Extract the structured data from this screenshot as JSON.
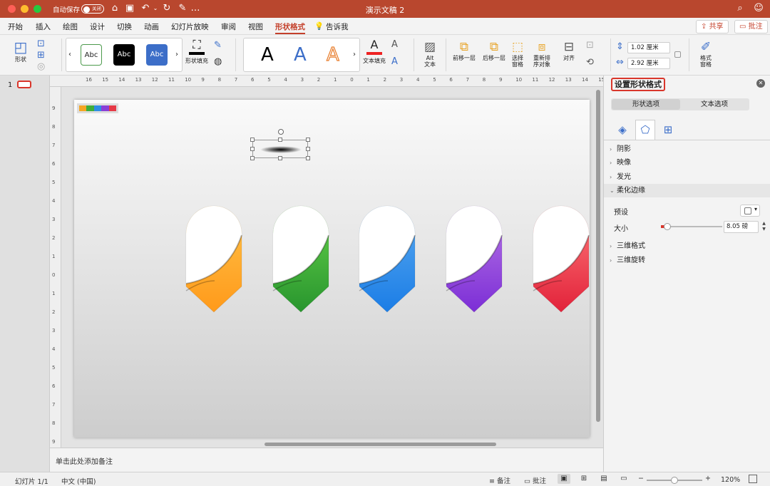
{
  "titlebar": {
    "autosave_label": "自动保存",
    "autosave_state": "关闭",
    "doc_title": "演示文稿 2"
  },
  "menu": {
    "tabs": [
      "开始",
      "插入",
      "绘图",
      "设计",
      "切换",
      "动画",
      "幻灯片放映",
      "审阅",
      "视图",
      "形状格式"
    ],
    "active_tab": "形状格式",
    "tell_me": "告诉我",
    "share": "共享",
    "comments": "批注"
  },
  "ribbon": {
    "shape_label": "形状",
    "style_presets": [
      "Abc",
      "Abc",
      "Abc"
    ],
    "shape_fill_label": "形状填充",
    "wordart_letter": "A",
    "text_fill_label": "文本填充",
    "alt_text_label": "Alt\n文本",
    "bring_forward": "前移一层",
    "send_backward": "后移一层",
    "selection_pane": "选择\n窗格",
    "reorder": "重新排\n序对象",
    "align": "对齐",
    "height_value": "1.02 厘米",
    "width_value": "2.92 厘米",
    "format_pane": "格式\n窗格",
    "accent_color": "#c4402b"
  },
  "thumbs": {
    "slide_number": "1"
  },
  "rulers": {
    "h_labels": [
      "16",
      "15",
      "14",
      "13",
      "12",
      "11",
      "10",
      "9",
      "8",
      "7",
      "6",
      "5",
      "4",
      "3",
      "2",
      "1",
      "0",
      "1",
      "2",
      "3",
      "4",
      "5",
      "6",
      "7",
      "8",
      "9",
      "10",
      "11",
      "12",
      "13",
      "14",
      "15",
      "16"
    ],
    "v_labels": [
      "9",
      "8",
      "7",
      "6",
      "5",
      "4",
      "3",
      "2",
      "1",
      "0",
      "1",
      "2",
      "3",
      "4",
      "5",
      "6",
      "7",
      "8",
      "9"
    ]
  },
  "notes": {
    "placeholder": "单击此处添加备注"
  },
  "pane": {
    "title": "设置形状格式",
    "tabs": [
      "形状选项",
      "文本选项"
    ],
    "icons": [
      "fill-line-icon",
      "effects-icon",
      "size-properties-icon"
    ],
    "sections": [
      {
        "label": "阴影",
        "expanded": false
      },
      {
        "label": "映像",
        "expanded": false
      },
      {
        "label": "发光",
        "expanded": false
      },
      {
        "label": "柔化边缘",
        "expanded": true
      },
      {
        "label": "三维格式",
        "expanded": false
      },
      {
        "label": "三维旋转",
        "expanded": false
      }
    ],
    "preset_label": "预设",
    "size_label": "大小",
    "size_value": "8.05 磅",
    "slider_fraction": 0.1
  },
  "slide": {
    "banners": [
      {
        "top": "#ffc24a",
        "bottom": "#ff9a1a"
      },
      {
        "top": "#66d24a",
        "bottom": "#28952e"
      },
      {
        "top": "#5aaaf0",
        "bottom": "#1b7de6"
      },
      {
        "top": "#b878e6",
        "bottom": "#7c2ed6"
      },
      {
        "top": "#ff7b7b",
        "bottom": "#e2223a"
      }
    ],
    "palette": [
      "#f6a623",
      "#3fae3b",
      "#2f8de4",
      "#8a3fd6",
      "#e63946"
    ]
  },
  "status": {
    "slide_counter": "幻灯片 1/1",
    "language": "中文 (中国)",
    "notes_btn": "备注",
    "comments_btn": "批注",
    "zoom": "120%"
  }
}
